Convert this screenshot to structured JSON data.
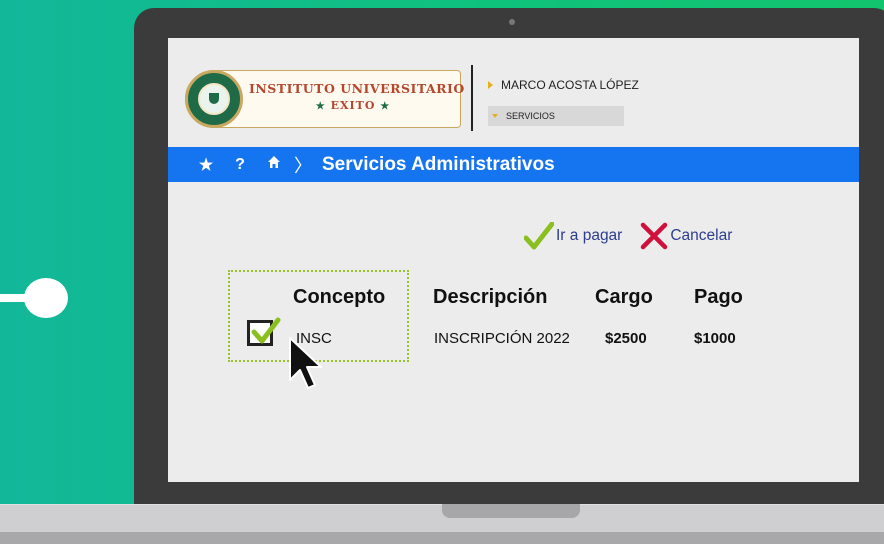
{
  "school": {
    "name": "INSTITUTO UNIVERSITARIO",
    "subtitle": "EXITO"
  },
  "user": {
    "name": "MARCO ACOSTA LÓPEZ"
  },
  "menu": {
    "services_label": "SERVICIOS"
  },
  "nav": {
    "title": "Servicios Administrativos",
    "icons": [
      "star-icon",
      "help-icon",
      "home-icon"
    ]
  },
  "actions": {
    "pay_label": "Ir a pagar",
    "cancel_label": "Cancelar"
  },
  "table": {
    "headers": [
      "Concepto",
      "Descripción",
      "Cargo",
      "Pago"
    ],
    "rows": [
      {
        "checked": true,
        "concepto": "INSC",
        "descripcion": "INSCRIPCIÓN 2022",
        "cargo": "$2500",
        "pago": "$1000"
      }
    ]
  },
  "colors": {
    "background": "#12c48a",
    "navbar": "#1574f0",
    "accent_check": "#8bbf1f",
    "cancel_x": "#d0103a",
    "action_text": "#2c3d8f"
  }
}
